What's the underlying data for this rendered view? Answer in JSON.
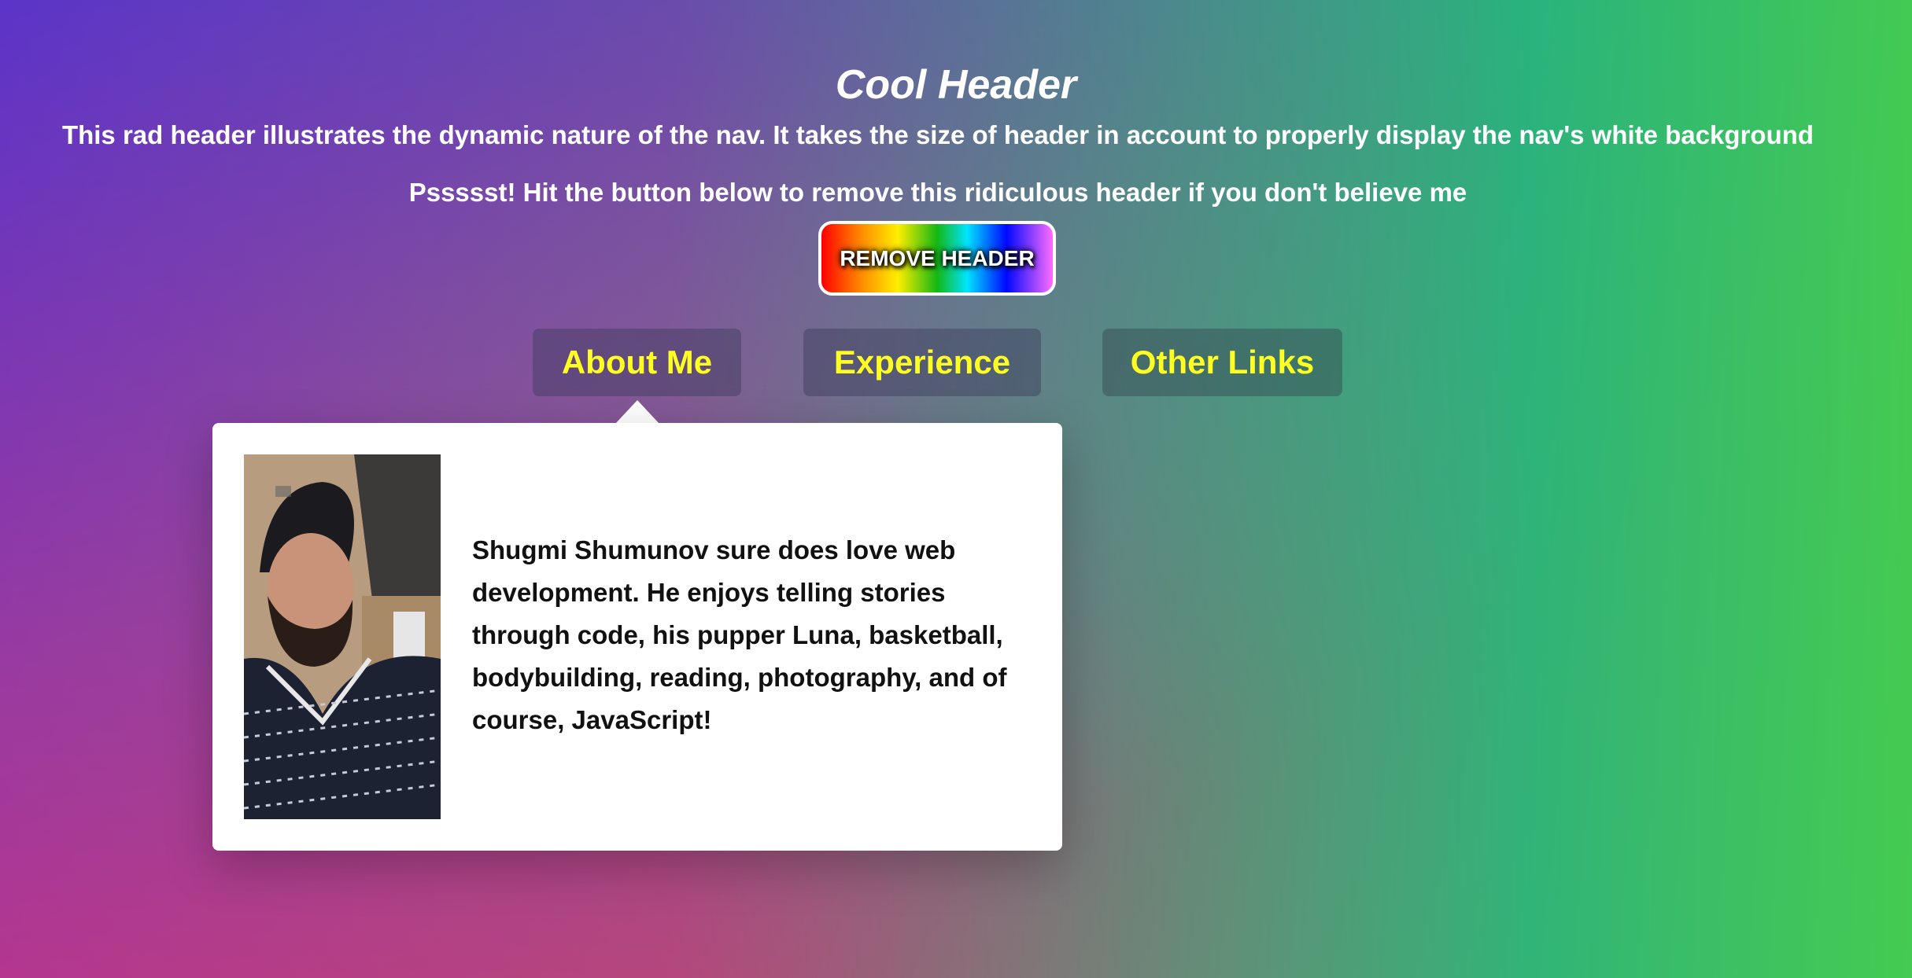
{
  "header": {
    "title": "Cool Header",
    "subtitle": "This rad header illustrates the dynamic nature of the nav. It takes the size of header in account to properly display the nav's white background",
    "hint": "Pssssst! Hit the button below to remove this ridiculous header if you don't believe me",
    "remove_button_label": "REMOVE HEADER"
  },
  "nav": {
    "items": [
      {
        "label": "About Me",
        "active": true
      },
      {
        "label": "Experience",
        "active": false
      },
      {
        "label": "Other Links",
        "active": false
      }
    ]
  },
  "dropdown": {
    "photo_icon": "profile-photo",
    "bio": "Shugmi Shumunov sure does love web development. He enjoys telling stories through code, his pupper Luna, basketball, bodybuilding, reading, photography, and of course, JavaScript!"
  },
  "colors": {
    "nav_text": "#ffff22",
    "header_text": "#ffffff",
    "dropdown_bg": "#ffffff"
  }
}
